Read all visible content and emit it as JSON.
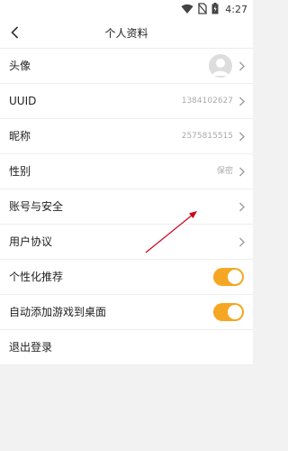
{
  "status_bar": {
    "time": "4:27",
    "icons": [
      "wifi-icon",
      "no-sim-icon",
      "battery-icon"
    ]
  },
  "header": {
    "title": "个人资料",
    "back_icon": "back-chevron-icon"
  },
  "rows": {
    "avatar": {
      "label": "头像"
    },
    "uuid": {
      "label": "UUID",
      "value": "1384102627"
    },
    "nickname": {
      "label": "昵称",
      "value": "2575815515"
    },
    "gender": {
      "label": "性别",
      "value": "保密"
    },
    "security": {
      "label": "账号与安全"
    },
    "agreement": {
      "label": "用户协议"
    },
    "personalized": {
      "label": "个性化推荐",
      "enabled": true
    },
    "auto_add_game": {
      "label": "自动添加游戏到桌面",
      "enabled": true
    },
    "logout": {
      "label": "退出登录"
    }
  },
  "colors": {
    "accent": "#f5a623",
    "annotation_arrow": "#d0021b",
    "background": "#f2f2f2"
  }
}
